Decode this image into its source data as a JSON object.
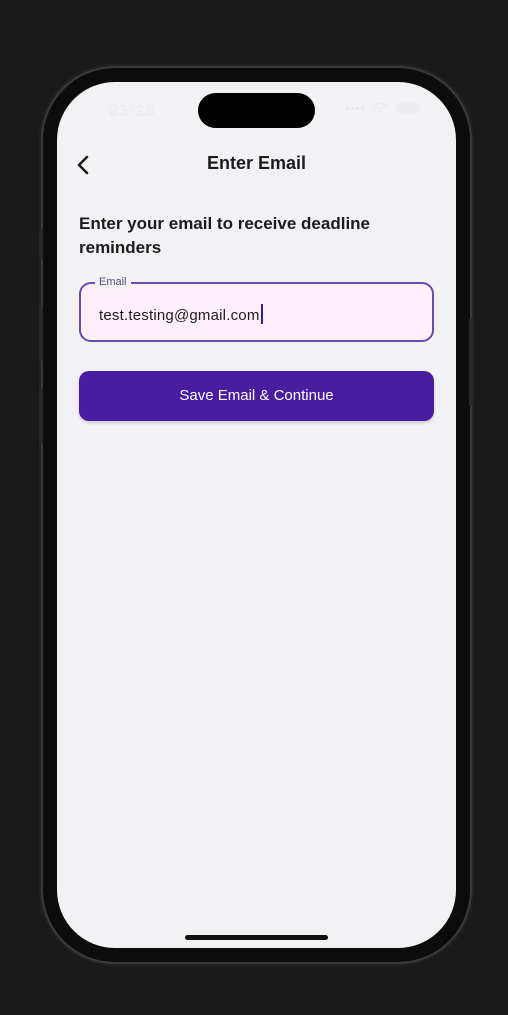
{
  "status_bar": {
    "time": "23:28"
  },
  "nav": {
    "title": "Enter Email",
    "back_icon": "chevron-left-icon"
  },
  "main": {
    "heading": "Enter your email to receive deadline reminders",
    "email_field": {
      "label": "Email",
      "value": "test.testing@gmail.com"
    },
    "save_button_label": "Save Email & Continue"
  },
  "colors": {
    "accent": "#4a1ca0",
    "field_border": "#6a4aa8",
    "field_background": "#fcf0fb",
    "screen_background": "#f2f2f4",
    "page_background": "#1a1a1a"
  }
}
